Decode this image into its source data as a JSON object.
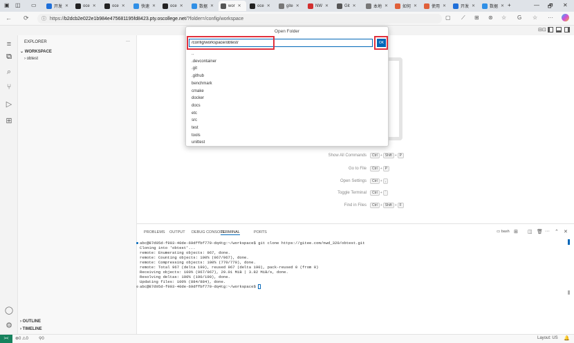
{
  "browser": {
    "tabs": [
      {
        "label": "开发",
        "color": "#1e6fd9"
      },
      {
        "label": "oce",
        "color": "#222222"
      },
      {
        "label": "oce",
        "color": "#222222"
      },
      {
        "label": "快速",
        "color": "#2f8fe6"
      },
      {
        "label": "oce",
        "color": "#222222"
      },
      {
        "label": "数据",
        "color": "#2f8fe6"
      },
      {
        "label": "wor",
        "color": "#555555"
      },
      {
        "label": "oce",
        "color": "#222222"
      },
      {
        "label": "gite",
        "color": "#777777"
      },
      {
        "label": "NW",
        "color": "#d22f2f"
      },
      {
        "label": "Git",
        "color": "#555555"
      },
      {
        "label": "本地",
        "color": "#777777"
      },
      {
        "label": "如何",
        "color": "#e0603a"
      },
      {
        "label": "使用",
        "color": "#e0603a"
      },
      {
        "label": "开发",
        "color": "#1e6fd9"
      },
      {
        "label": "数据",
        "color": "#2f8fe6"
      }
    ],
    "url_prefix": "https://",
    "url_host": "b2dcb2e022e1b984e475681195fd8423.pty.oscollege.net",
    "url_path": "/?folder=/config/workspace"
  },
  "sidebar": {
    "title": "EXPLORER",
    "more": "···",
    "workspace": "WORKSPACE",
    "folder": "obtest",
    "outline": "OUTLINE",
    "timeline": "TIMELINE"
  },
  "dialog": {
    "title": "Open Folder",
    "input_value": "/config/workspace/obtest/",
    "ok_label": "OK",
    "items": [
      "..",
      ".devcontainer",
      ".git",
      ".github",
      "benchmark",
      "cmake",
      "docker",
      "docs",
      "etc",
      "src",
      "test",
      "tools",
      "unittest"
    ]
  },
  "editor": {
    "commands": [
      {
        "label": "Show All Commands",
        "keys": [
          "Ctrl",
          "Shift",
          "P"
        ]
      },
      {
        "label": "Go to File",
        "keys": [
          "Ctrl",
          "P"
        ]
      },
      {
        "label": "Open Settings",
        "keys": [
          "Ctrl",
          ","
        ]
      },
      {
        "label": "Toggle Terminal",
        "keys": [
          "Ctrl",
          "`"
        ]
      },
      {
        "label": "Find in Files",
        "keys": [
          "Ctrl",
          "Shift",
          "F"
        ]
      }
    ]
  },
  "panel": {
    "tabs": [
      "PROBLEMS",
      "OUTPUT",
      "DEBUG CONSOLE",
      "TERMINAL",
      "PORTS"
    ],
    "active_tab": "TERMINAL",
    "terminal_name": "bash",
    "terminal_lines": [
      "abc@87d95d-f903-40de-69dffbf779-dq4tg:~/workspace$ git clone https://gitee.com/nwd_320/obtest.git",
      "Cloning into 'obtest'...",
      "remote: Enumerating objects: 967, done.",
      "remote: Counting objects: 100% (967/967), done.",
      "remote: Compressing objects: 100% (770/770), done.",
      "remote: Total 967 (delta 190), reused 967 (delta 190), pack-reused 0 (from 0)",
      "Receiving objects: 100% (967/967), 29.01 MiB | 3.82 MiB/s, done.",
      "Resolving deltas: 100% (190/190), done.",
      "Updating files: 100% (884/884), done.",
      "abc@87d95d-f903-40de-69dffbf779-dq4tg:~/workspace$ "
    ]
  },
  "status": {
    "remote": "><",
    "errors": "0",
    "warnings": "0",
    "ports": "0",
    "layout": "Layout: US"
  },
  "colors": {
    "accent": "#0066b8",
    "highlight": "#e0303c",
    "status_remote": "#16825d"
  }
}
